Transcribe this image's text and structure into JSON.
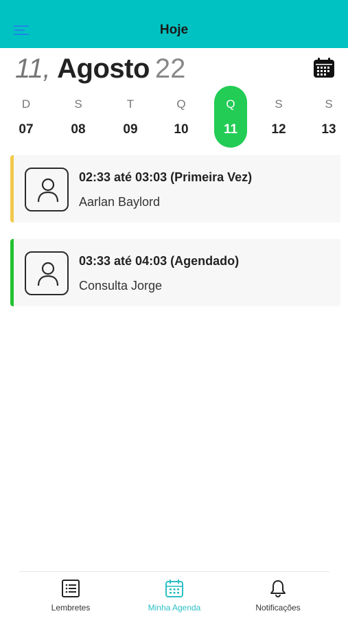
{
  "header": {
    "title": "Hoje",
    "accent": "#00c2c2"
  },
  "date": {
    "day": "11,",
    "month": "Agosto",
    "year": "22"
  },
  "week": [
    {
      "letter": "D",
      "num": "07"
    },
    {
      "letter": "S",
      "num": "08"
    },
    {
      "letter": "T",
      "num": "09"
    },
    {
      "letter": "Q",
      "num": "10"
    },
    {
      "letter": "Q",
      "num": "11",
      "selected": true
    },
    {
      "letter": "S",
      "num": "12"
    },
    {
      "letter": "S",
      "num": "13"
    }
  ],
  "selected_color": "#22cc55",
  "appointments": [
    {
      "time": "02:33 até 03:03 (Primeira Vez)",
      "name": "Aarlan Baylord",
      "status_color": "#f2c94c",
      "icon": "user-icon"
    },
    {
      "time": "03:33 até 04:03 (Agendado)",
      "name": "Consulta Jorge",
      "status_color": "#22c233",
      "icon": "user-icon"
    }
  ],
  "nav": {
    "items": [
      {
        "label": "Lembretes",
        "icon": "list-icon"
      },
      {
        "label": "Minha Agenda",
        "icon": "calendar-icon",
        "active": true
      },
      {
        "label": "Notificações",
        "icon": "bell-icon"
      }
    ],
    "active_color": "#2bbfc4"
  }
}
